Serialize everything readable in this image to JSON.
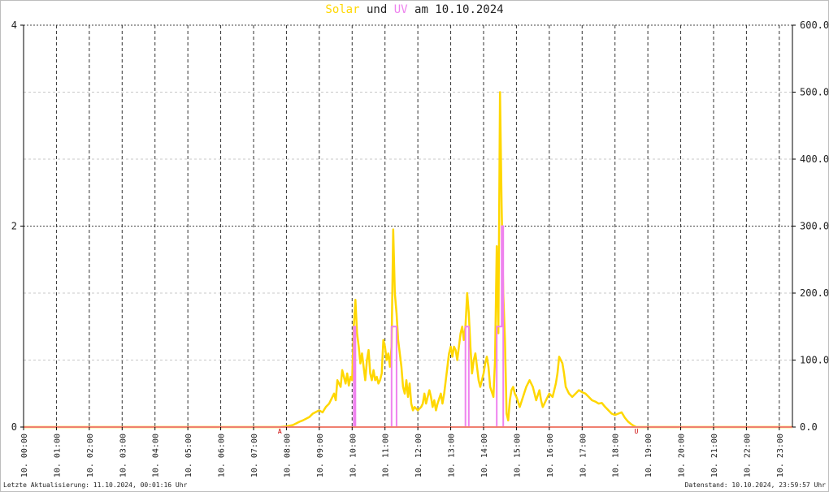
{
  "title": {
    "solar_word": "Solar",
    "und_word": "und",
    "uv_word": "UV",
    "date_text": "am 10.10.2024",
    "solar_color": "#ffd700",
    "uv_color": "#ee82ee"
  },
  "footer": {
    "left": "Letzte Aktualisierung: 11.10.2024, 00:01:16 Uhr",
    "right": "Datenstand: 10.10.2024, 23:59:57 Uhr"
  },
  "chart_data": {
    "type": "line",
    "x_unit": "hour",
    "xlim": [
      0,
      23.4
    ],
    "x_ticks": [
      0,
      1,
      2,
      3,
      4,
      5,
      6,
      7,
      8,
      9,
      10,
      11,
      12,
      13,
      14,
      15,
      16,
      17,
      18,
      19,
      20,
      21,
      22,
      23
    ],
    "x_tick_labels": [
      "10. 00:00",
      "10. 01:00",
      "10. 02:00",
      "10. 03:00",
      "10. 04:00",
      "10. 05:00",
      "10. 06:00",
      "10. 07:00",
      "10. 08:00",
      "10. 09:00",
      "10. 10:00",
      "10. 11:00",
      "10. 12:00",
      "10. 13:00",
      "10. 14:00",
      "10. 15:00",
      "10. 16:00",
      "10. 17:00",
      "10. 18:00",
      "10. 19:00",
      "10. 20:00",
      "10. 21:00",
      "10. 22:00",
      "10. 23:00"
    ],
    "y_left": {
      "lim": [
        0,
        4
      ],
      "ticks": [
        0,
        2,
        4
      ],
      "tick_labels": [
        "0",
        "2",
        "4"
      ]
    },
    "y_right": {
      "lim": [
        0,
        600
      ],
      "ticks": [
        0,
        100,
        200,
        300,
        400,
        500,
        600
      ],
      "tick_labels": [
        "0.0",
        "100.0",
        "200.0",
        "300.0",
        "400.0",
        "500.0",
        "600.0"
      ]
    },
    "grid": true,
    "markers": [
      {
        "label": "A",
        "x": 7.8,
        "color": "#cc0000"
      },
      {
        "label": "U",
        "x": 18.65,
        "color": "#cc0000"
      }
    ],
    "series": [
      {
        "name": "Solar",
        "axis": "right",
        "color": "#ffd700",
        "points": [
          [
            0,
            0
          ],
          [
            7.8,
            0
          ],
          [
            8.0,
            1
          ],
          [
            8.2,
            3
          ],
          [
            8.4,
            8
          ],
          [
            8.5,
            10
          ],
          [
            8.7,
            15
          ],
          [
            8.8,
            20
          ],
          [
            9.0,
            25
          ],
          [
            9.1,
            22
          ],
          [
            9.2,
            30
          ],
          [
            9.3,
            35
          ],
          [
            9.45,
            50
          ],
          [
            9.5,
            40
          ],
          [
            9.55,
            70
          ],
          [
            9.65,
            60
          ],
          [
            9.7,
            85
          ],
          [
            9.8,
            65
          ],
          [
            9.85,
            80
          ],
          [
            9.9,
            62
          ],
          [
            9.95,
            75
          ],
          [
            10.0,
            70
          ],
          [
            10.05,
            150
          ],
          [
            10.1,
            190
          ],
          [
            10.15,
            140
          ],
          [
            10.2,
            120
          ],
          [
            10.25,
            95
          ],
          [
            10.3,
            110
          ],
          [
            10.4,
            70
          ],
          [
            10.45,
            100
          ],
          [
            10.5,
            115
          ],
          [
            10.55,
            80
          ],
          [
            10.6,
            70
          ],
          [
            10.65,
            85
          ],
          [
            10.7,
            70
          ],
          [
            10.75,
            75
          ],
          [
            10.8,
            65
          ],
          [
            10.85,
            70
          ],
          [
            10.9,
            80
          ],
          [
            10.95,
            130
          ],
          [
            11.0,
            120
          ],
          [
            11.05,
            100
          ],
          [
            11.1,
            110
          ],
          [
            11.15,
            90
          ],
          [
            11.2,
            120
          ],
          [
            11.25,
            295
          ],
          [
            11.3,
            200
          ],
          [
            11.35,
            170
          ],
          [
            11.4,
            130
          ],
          [
            11.5,
            90
          ],
          [
            11.55,
            60
          ],
          [
            11.6,
            50
          ],
          [
            11.65,
            70
          ],
          [
            11.7,
            45
          ],
          [
            11.75,
            65
          ],
          [
            11.8,
            35
          ],
          [
            11.85,
            25
          ],
          [
            11.9,
            30
          ],
          [
            12.0,
            25
          ],
          [
            12.1,
            30
          ],
          [
            12.15,
            35
          ],
          [
            12.2,
            50
          ],
          [
            12.25,
            35
          ],
          [
            12.35,
            55
          ],
          [
            12.4,
            45
          ],
          [
            12.45,
            30
          ],
          [
            12.5,
            40
          ],
          [
            12.55,
            25
          ],
          [
            12.6,
            35
          ],
          [
            12.7,
            50
          ],
          [
            12.75,
            35
          ],
          [
            12.8,
            50
          ],
          [
            12.85,
            70
          ],
          [
            12.9,
            90
          ],
          [
            12.95,
            110
          ],
          [
            13.0,
            120
          ],
          [
            13.05,
            105
          ],
          [
            13.1,
            120
          ],
          [
            13.15,
            115
          ],
          [
            13.2,
            100
          ],
          [
            13.3,
            140
          ],
          [
            13.35,
            150
          ],
          [
            13.4,
            130
          ],
          [
            13.45,
            150
          ],
          [
            13.5,
            200
          ],
          [
            13.55,
            170
          ],
          [
            13.6,
            120
          ],
          [
            13.65,
            80
          ],
          [
            13.7,
            100
          ],
          [
            13.75,
            110
          ],
          [
            13.8,
            90
          ],
          [
            13.85,
            70
          ],
          [
            13.9,
            60
          ],
          [
            14.0,
            80
          ],
          [
            14.05,
            95
          ],
          [
            14.1,
            105
          ],
          [
            14.15,
            90
          ],
          [
            14.2,
            60
          ],
          [
            14.3,
            45
          ],
          [
            14.35,
            100
          ],
          [
            14.4,
            270
          ],
          [
            14.45,
            140
          ],
          [
            14.5,
            500
          ],
          [
            14.55,
            330
          ],
          [
            14.6,
            200
          ],
          [
            14.65,
            130
          ],
          [
            14.7,
            20
          ],
          [
            14.75,
            10
          ],
          [
            14.8,
            40
          ],
          [
            14.85,
            55
          ],
          [
            14.9,
            60
          ],
          [
            14.95,
            50
          ],
          [
            15.0,
            45
          ],
          [
            15.1,
            30
          ],
          [
            15.2,
            45
          ],
          [
            15.3,
            60
          ],
          [
            15.4,
            70
          ],
          [
            15.5,
            60
          ],
          [
            15.6,
            40
          ],
          [
            15.7,
            55
          ],
          [
            15.75,
            40
          ],
          [
            15.8,
            30
          ],
          [
            15.9,
            40
          ],
          [
            16.0,
            50
          ],
          [
            16.1,
            45
          ],
          [
            16.2,
            65
          ],
          [
            16.25,
            80
          ],
          [
            16.3,
            105
          ],
          [
            16.4,
            95
          ],
          [
            16.45,
            80
          ],
          [
            16.5,
            60
          ],
          [
            16.6,
            50
          ],
          [
            16.7,
            45
          ],
          [
            16.8,
            50
          ],
          [
            16.9,
            55
          ],
          [
            17.0,
            52
          ],
          [
            17.1,
            50
          ],
          [
            17.2,
            45
          ],
          [
            17.3,
            40
          ],
          [
            17.4,
            38
          ],
          [
            17.5,
            35
          ],
          [
            17.6,
            36
          ],
          [
            17.7,
            30
          ],
          [
            17.8,
            25
          ],
          [
            17.9,
            20
          ],
          [
            18.0,
            18
          ],
          [
            18.1,
            20
          ],
          [
            18.2,
            22
          ],
          [
            18.25,
            18
          ],
          [
            18.3,
            14
          ],
          [
            18.4,
            8
          ],
          [
            18.5,
            4
          ],
          [
            18.6,
            1
          ],
          [
            18.65,
            0
          ],
          [
            23.4,
            0
          ]
        ]
      },
      {
        "name": "UV",
        "axis": "left",
        "color": "#ee82ee",
        "points": [
          [
            0,
            0
          ],
          [
            10.05,
            0
          ],
          [
            10.05,
            1
          ],
          [
            10.1,
            1
          ],
          [
            10.1,
            0
          ],
          [
            11.2,
            0
          ],
          [
            11.2,
            1
          ],
          [
            11.35,
            1
          ],
          [
            11.35,
            0
          ],
          [
            13.45,
            0
          ],
          [
            13.45,
            1
          ],
          [
            13.55,
            1
          ],
          [
            13.55,
            0
          ],
          [
            14.4,
            0
          ],
          [
            14.4,
            1
          ],
          [
            14.55,
            1
          ],
          [
            14.55,
            2
          ],
          [
            14.6,
            2
          ],
          [
            14.6,
            0
          ],
          [
            23.4,
            0
          ]
        ]
      }
    ]
  }
}
